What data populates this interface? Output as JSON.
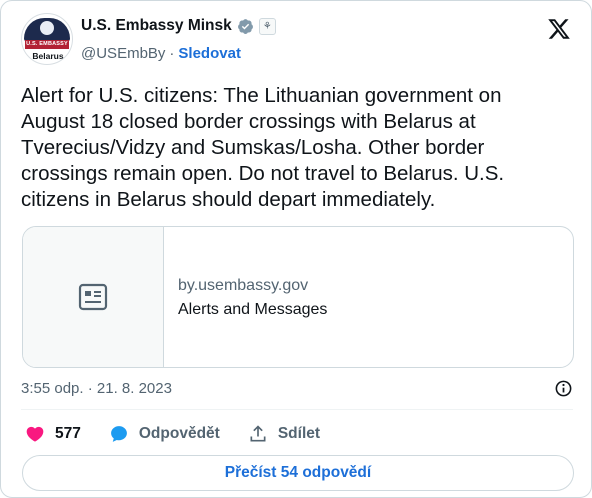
{
  "account": {
    "name": "U.S. Embassy Minsk",
    "handle": "@USEmbBy",
    "separator": "·",
    "follow_label": "Sledovat",
    "avatar_banner": "U.S. EMBASSY",
    "avatar_country": "Belarus"
  },
  "tweet": {
    "text": "Alert for U.S. citizens: The Lithuanian government on August 18 closed border crossings with Belarus at Tverecius/Vidzy and Sumskas/Losha. Other border crossings remain open. Do not travel to Belarus. U.S. citizens in Belarus should depart immediately."
  },
  "link_card": {
    "domain": "by.usembassy.gov",
    "title": "Alerts and Messages",
    "thumb_icon": "article-icon"
  },
  "meta": {
    "timestamp": "3:55 odp. · 21. 8. 2023"
  },
  "actions": {
    "like_count": "577",
    "reply_label": "Odpovědět",
    "share_label": "Sdílet"
  },
  "read_replies_label": "Přečíst 54 odpovědí",
  "colors": {
    "accent": "#1d6fd8",
    "like": "#f91880",
    "verified": "#1d9bf0",
    "muted": "#536471",
    "text": "#0f1419",
    "border": "#cfd9de"
  },
  "icons": [
    "verified-badge-icon",
    "government-label-icon",
    "x-logo-icon",
    "article-icon",
    "info-icon",
    "heart-icon",
    "reply-bubble-icon",
    "share-icon"
  ]
}
